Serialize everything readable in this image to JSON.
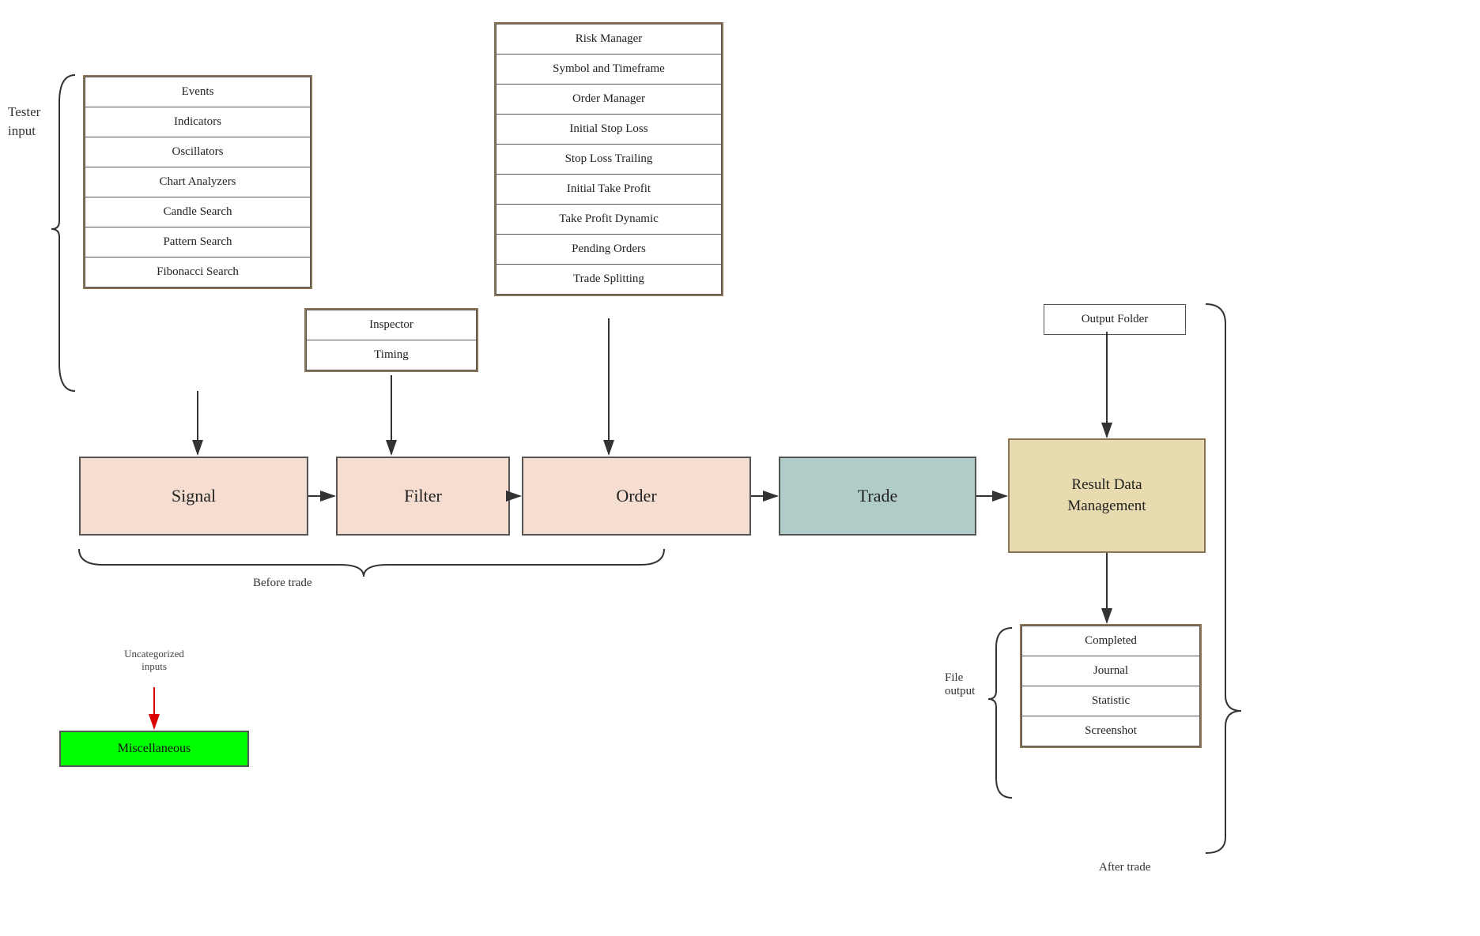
{
  "tester_input": {
    "label": "Tester\ninput"
  },
  "signal_stack": {
    "items": [
      "Events",
      "Indicators",
      "Oscillators",
      "Chart Analyzers",
      "Candle Search",
      "Pattern Search",
      "Fibonacci Search"
    ]
  },
  "filter_stack": {
    "items": [
      "Inspector",
      "Timing"
    ]
  },
  "order_stack": {
    "items": [
      "Risk Manager",
      "Symbol and Timeframe",
      "Order Manager",
      "Initial Stop Loss",
      "Stop Loss Trailing",
      "Initial Take Profit",
      "Take Profit Dynamic",
      "Pending Orders",
      "Trade Splitting"
    ]
  },
  "flow": {
    "signal": "Signal",
    "filter": "Filter",
    "order": "Order",
    "trade": "Trade",
    "result": "Result Data\nManagement"
  },
  "labels": {
    "before_trade": "Before trade",
    "after_trade": "After trade",
    "file_output": "File\noutput",
    "uncategorized": "Uncategorized\ninputs"
  },
  "output_folder": "Output Folder",
  "file_outputs": [
    "Completed",
    "Journal",
    "Statistic",
    "Screenshot"
  ],
  "misc": "Miscellaneous"
}
